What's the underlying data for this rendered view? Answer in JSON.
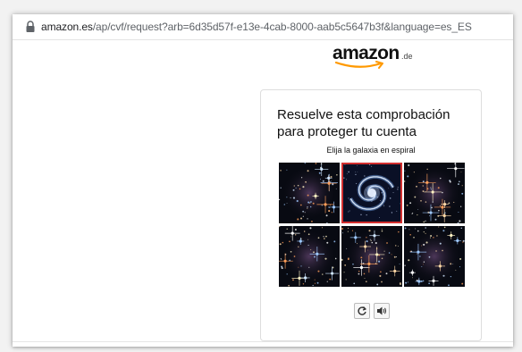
{
  "browser": {
    "url_domain": "amazon.es",
    "url_path": "/ap/cvf/request?arb=6d35d57f-e13e-4cab-8000-aab5c5647b3f&language=es_ES",
    "lock_icon": "lock-icon"
  },
  "logo": {
    "word": "amazon",
    "suffix": ".de",
    "accent": "#ff9900"
  },
  "captcha": {
    "title": "Resuelve esta comprobación para proteger tu cuenta",
    "instruction": "Elija la galaxia en espiral",
    "tiles": [
      {
        "kind": "star-cluster",
        "selected": false
      },
      {
        "kind": "spiral-galaxy",
        "selected": true
      },
      {
        "kind": "star-cluster",
        "selected": false
      },
      {
        "kind": "star-cluster",
        "selected": false
      },
      {
        "kind": "star-cluster",
        "selected": false
      },
      {
        "kind": "star-cluster",
        "selected": false
      }
    ],
    "selection_color": "#d32f2f",
    "controls": {
      "refresh_icon": "refresh-icon",
      "audio_icon": "speaker-icon"
    }
  }
}
